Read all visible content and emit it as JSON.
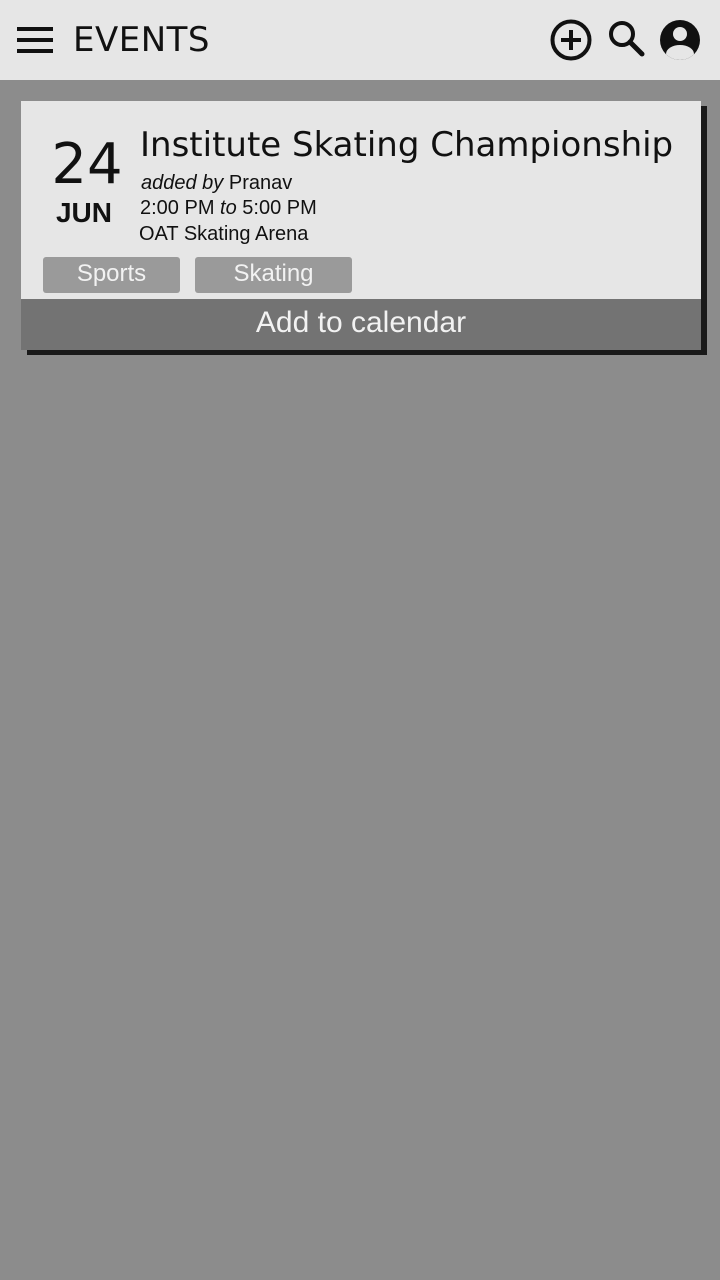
{
  "appbar": {
    "title": "EVENTS",
    "menu_icon": "hamburger-menu-icon",
    "add_icon": "add-circle-icon",
    "search_icon": "search-icon",
    "account_icon": "account-circle-icon"
  },
  "event": {
    "day": "24",
    "month": "JUN",
    "title": "Institute Skating Championship",
    "added_by_prefix": "added by",
    "added_by": "Pranav",
    "start_time": "2:00 PM",
    "time_separator": "to",
    "end_time": "5:00 PM",
    "venue": "OAT Skating Arena",
    "tags": [
      "Sports",
      "Skating"
    ],
    "action_label": "Add to calendar"
  },
  "colors": {
    "background": "#8c8c8c",
    "appbar": "#e6e6e6",
    "card": "#e6e6e6",
    "tag": "#9a9a9a",
    "action_bar": "#737373"
  }
}
